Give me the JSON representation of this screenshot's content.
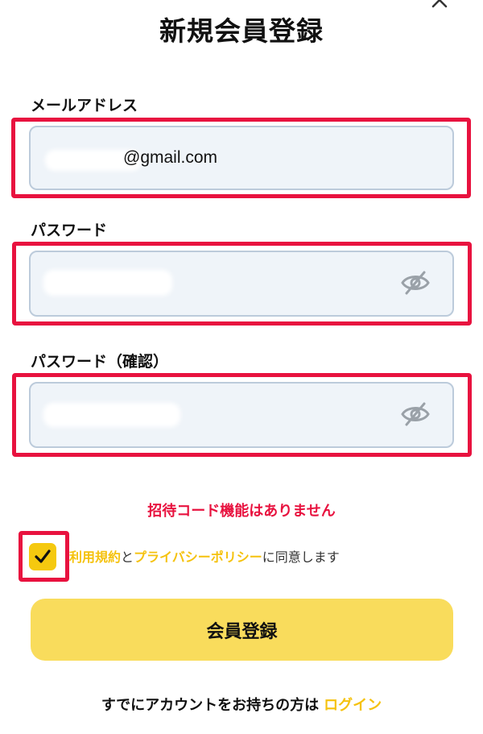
{
  "header": {
    "title": "新規会員登録",
    "close_icon": "close-icon"
  },
  "form": {
    "email": {
      "label": "メールアドレス",
      "value_suffix": "@gmail.com"
    },
    "password": {
      "label": "パスワード",
      "toggle_icon": "eye-off-icon"
    },
    "password_confirm": {
      "label": "パスワード（確認）",
      "toggle_icon": "eye-off-icon"
    }
  },
  "notice": "招待コード機能はありません",
  "agreement": {
    "checked": true,
    "terms_link": "利用規約",
    "conjunction": "と",
    "privacy_link": "プライバシーポリシー",
    "suffix": "に同意します"
  },
  "submit_label": "会員登録",
  "footer": {
    "prompt": "すでにアカウントをお持ちの方は",
    "login_link": "ログイン"
  },
  "colors": {
    "accent_yellow": "#f5c20e",
    "button_yellow": "#f9dc5c",
    "highlight_red": "#e8123f",
    "input_bg": "#eff4f9"
  }
}
